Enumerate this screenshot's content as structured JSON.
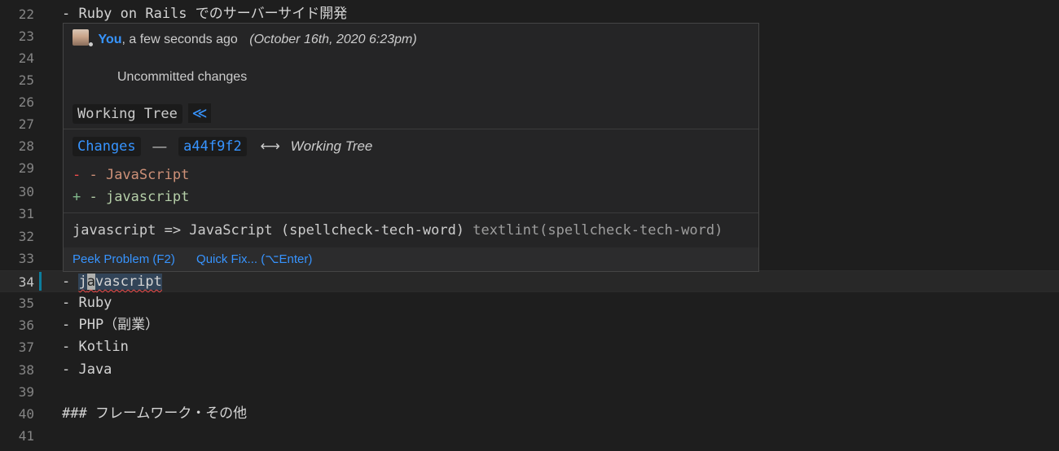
{
  "editor": {
    "lines": [
      {
        "number": "22",
        "text": "- Ruby on Rails でのサーバーサイド開発"
      },
      {
        "number": "23",
        "text": ""
      },
      {
        "number": "24",
        "text": ""
      },
      {
        "number": "25",
        "text": ""
      },
      {
        "number": "26",
        "text": ""
      },
      {
        "number": "27",
        "text": ""
      },
      {
        "number": "28",
        "text": ""
      },
      {
        "number": "29",
        "text": ""
      },
      {
        "number": "30",
        "text": ""
      },
      {
        "number": "31",
        "text": ""
      },
      {
        "number": "32",
        "text": ""
      },
      {
        "number": "33",
        "text": ""
      },
      {
        "number": "34",
        "prefix": "- ",
        "word_before_cursor": "j",
        "cursor_char": "a",
        "word_after_cursor": "vascript"
      },
      {
        "number": "35",
        "text": "- Ruby"
      },
      {
        "number": "36",
        "text": "- PHP（副業）"
      },
      {
        "number": "37",
        "text": "- Kotlin"
      },
      {
        "number": "38",
        "text": "- Java"
      },
      {
        "number": "39",
        "text": ""
      },
      {
        "number": "40",
        "text": "### フレームワーク・その他"
      },
      {
        "number": "41",
        "text": ""
      }
    ]
  },
  "hover": {
    "author": "You",
    "relative_time": ", a few seconds ago",
    "date": "(October 16th, 2020 6:23pm)",
    "message": "Uncommitted changes",
    "working_tree_label": "Working Tree",
    "working_tree_chevron": "≪",
    "changes_label": "Changes",
    "dash": "—",
    "commit_sha": "a44f9f2",
    "arrow": "⟷",
    "compare_target": "Working Tree",
    "diff_removed_marker": "-",
    "diff_removed_text": " - JavaScript",
    "diff_added_marker": "+",
    "diff_added_text": " - javascript",
    "problem_message": "javascript => JavaScript (spellcheck-tech-word) ",
    "problem_source": "textlint(spellcheck-tech-word)",
    "actions": {
      "peek_problem": "Peek Problem (F2)",
      "quick_fix": "Quick Fix... (⌥Enter)"
    }
  },
  "colors": {
    "background": "#1e1e1e",
    "link": "#3794ff",
    "diff_removed": "#ce9178",
    "diff_added": "#b5cea8",
    "squiggle": "#f14c4c"
  }
}
